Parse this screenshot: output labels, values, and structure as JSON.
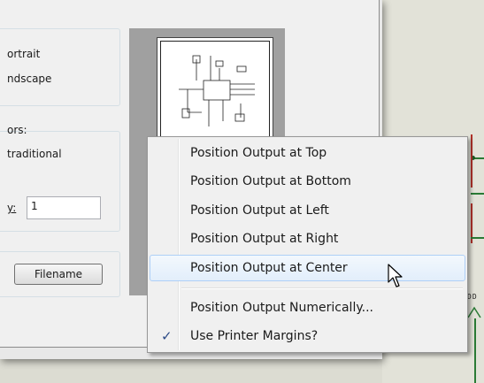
{
  "dialog": {
    "orientation_options": [
      "ortrait",
      "ndscape"
    ],
    "colors_label": "ors:",
    "colors_option": "traditional",
    "copies_label_fragment": "y:",
    "copies_value": "1",
    "filename_button": "Filename"
  },
  "schematic": {
    "net_label": "DD"
  },
  "context_menu": {
    "items": [
      {
        "label": "Position Output at Top",
        "checked": false,
        "highlighted": false
      },
      {
        "label": "Position Output at Bottom",
        "checked": false,
        "highlighted": false
      },
      {
        "label": "Position Output at Left",
        "checked": false,
        "highlighted": false
      },
      {
        "label": "Position Output at Right",
        "checked": false,
        "highlighted": false
      },
      {
        "label": "Position Output at Center",
        "checked": false,
        "highlighted": true
      },
      {
        "label": "Position Output Numerically...",
        "checked": false,
        "highlighted": false
      },
      {
        "label": "Use Printer Margins?",
        "checked": true,
        "highlighted": false
      }
    ],
    "check_icon": "checkmark-icon",
    "cursor_icon": "arrow-cursor-icon"
  }
}
